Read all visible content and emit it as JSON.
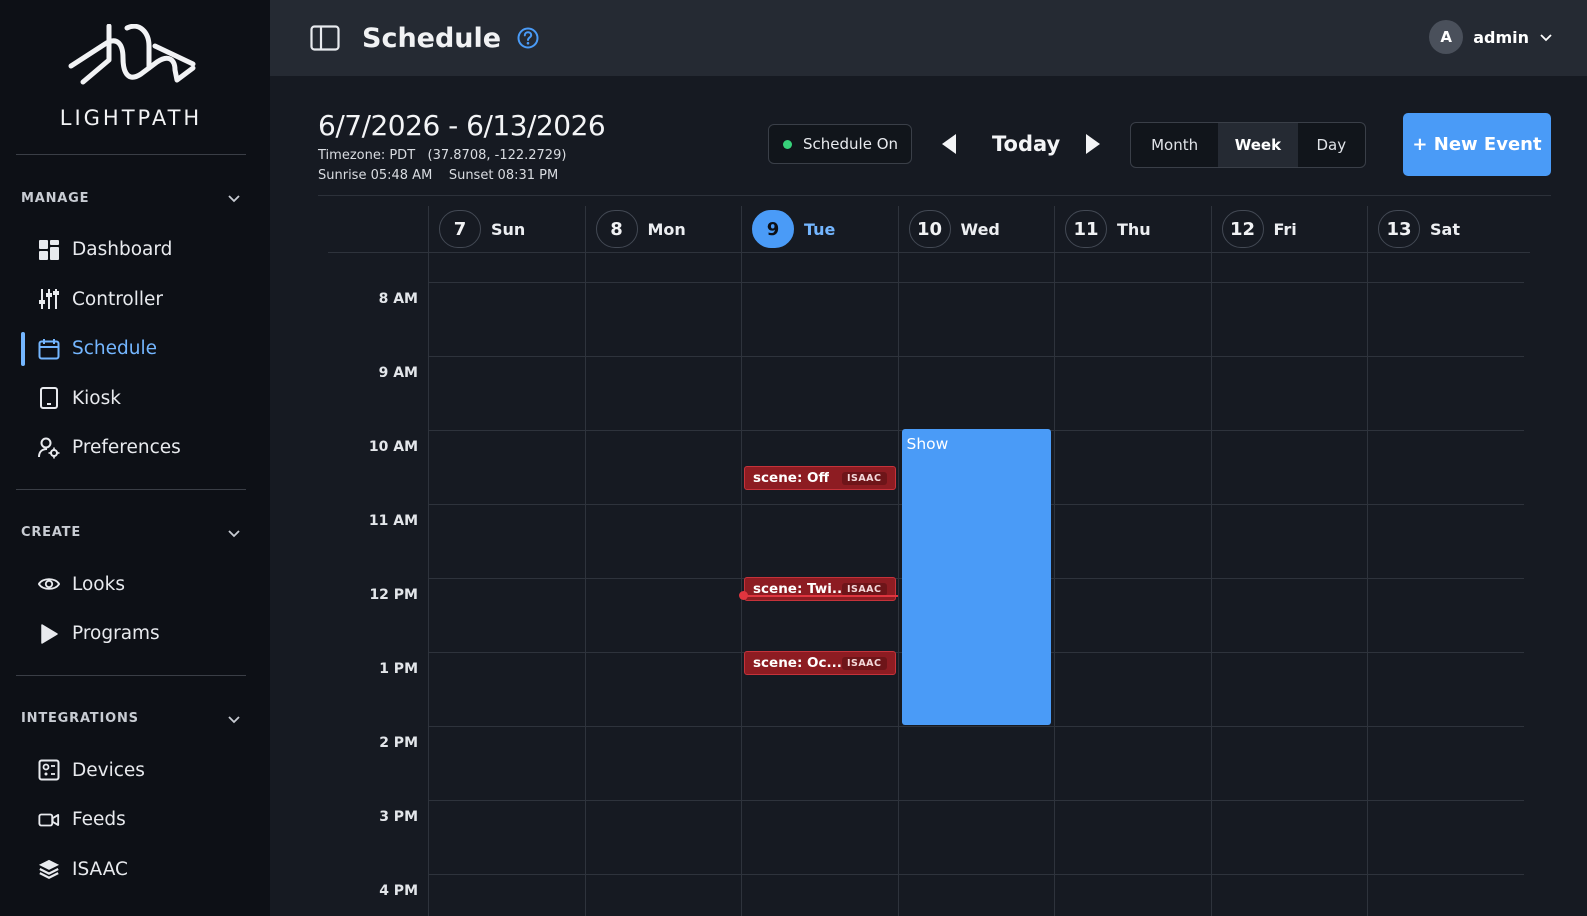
{
  "brand": {
    "name": "LIGHTPATH"
  },
  "sidebar": {
    "manage": {
      "title": "MANAGE",
      "items": [
        {
          "label": "Dashboard",
          "icon": "dashboard-icon"
        },
        {
          "label": "Controller",
          "icon": "sliders-icon"
        },
        {
          "label": "Schedule",
          "icon": "calendar-icon",
          "active": true
        },
        {
          "label": "Kiosk",
          "icon": "tablet-icon"
        },
        {
          "label": "Preferences",
          "icon": "user-gear-icon"
        }
      ]
    },
    "create": {
      "title": "CREATE",
      "items": [
        {
          "label": "Looks",
          "icon": "eye-icon"
        },
        {
          "label": "Programs",
          "icon": "play-icon"
        }
      ]
    },
    "integrations": {
      "title": "INTEGRATIONS",
      "items": [
        {
          "label": "Devices",
          "icon": "device-icon"
        },
        {
          "label": "Feeds",
          "icon": "video-camera-icon"
        },
        {
          "label": "ISAAC",
          "icon": "layers-icon"
        }
      ]
    }
  },
  "topbar": {
    "title": "Schedule",
    "user_initial": "A",
    "username": "admin"
  },
  "calendar": {
    "range": "6/7/2026 - 6/13/2026",
    "timezone_line": "Timezone: PDT   (37.8708, -122.2729)",
    "sun_line": "Sunrise 05:48 AM    Sunset 08:31 PM",
    "schedule_status": "Schedule On",
    "today_label": "Today",
    "views": {
      "month": "Month",
      "week": "Week",
      "day": "Day",
      "selected": "Week"
    },
    "new_event_label": "+ New Event",
    "days": [
      {
        "num": "7",
        "name": "Sun"
      },
      {
        "num": "8",
        "name": "Mon"
      },
      {
        "num": "9",
        "name": "Tue",
        "today": true
      },
      {
        "num": "10",
        "name": "Wed"
      },
      {
        "num": "11",
        "name": "Thu"
      },
      {
        "num": "12",
        "name": "Fri"
      },
      {
        "num": "13",
        "name": "Sat"
      }
    ],
    "hours": [
      "8 AM",
      "9 AM",
      "10 AM",
      "11 AM",
      "12 PM",
      "1 PM",
      "2 PM",
      "3 PM",
      "4 PM"
    ],
    "events": [
      {
        "text": "scene: Off",
        "badge": "ISAAC"
      },
      {
        "text": "scene: Twi...",
        "badge": "ISAAC"
      },
      {
        "text": "scene: Oc...",
        "badge": "ISAAC"
      }
    ],
    "show_event": {
      "text": "Show"
    },
    "colors": {
      "accent": "#4a9bf7",
      "event_red": "#8d1c22",
      "now_line": "#e0353f"
    }
  }
}
